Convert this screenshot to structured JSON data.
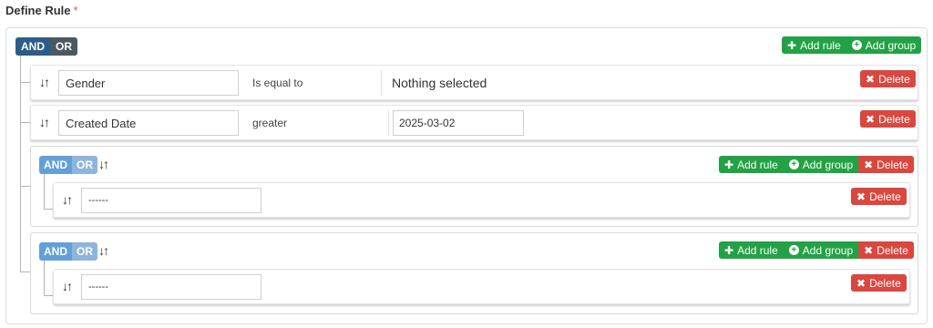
{
  "title": "Define Rule",
  "required_mark": "*",
  "root": {
    "and_label": "AND",
    "or_label": "OR",
    "add_rule": "Add rule",
    "add_group": "Add group"
  },
  "rules": [
    {
      "field": "Gender",
      "operator": "Is equal to",
      "value": "Nothing selected",
      "delete": "Delete"
    },
    {
      "field": "Created Date",
      "operator": "greater",
      "value": "2025-03-02",
      "delete": "Delete"
    }
  ],
  "groups": [
    {
      "and_label": "AND",
      "or_label": "OR",
      "add_rule": "Add rule",
      "add_group": "Add group",
      "delete": "Delete",
      "rule": {
        "field": "------",
        "delete": "Delete"
      }
    },
    {
      "and_label": "AND",
      "or_label": "OR",
      "add_rule": "Add rule",
      "add_group": "Add group",
      "delete": "Delete",
      "rule": {
        "field": "------",
        "delete": "Delete"
      }
    }
  ],
  "icons": {
    "sort": "sort-icon",
    "plus": "plus-icon",
    "plus_circle": "plus-circle-icon",
    "times": "times-icon"
  },
  "colors": {
    "green": "#22a245",
    "red": "#d9473f",
    "and_dark": "#2c5d8a",
    "or_dark": "#4b5963",
    "and_light": "#5b9bd5",
    "or_light": "#8fb5da"
  }
}
